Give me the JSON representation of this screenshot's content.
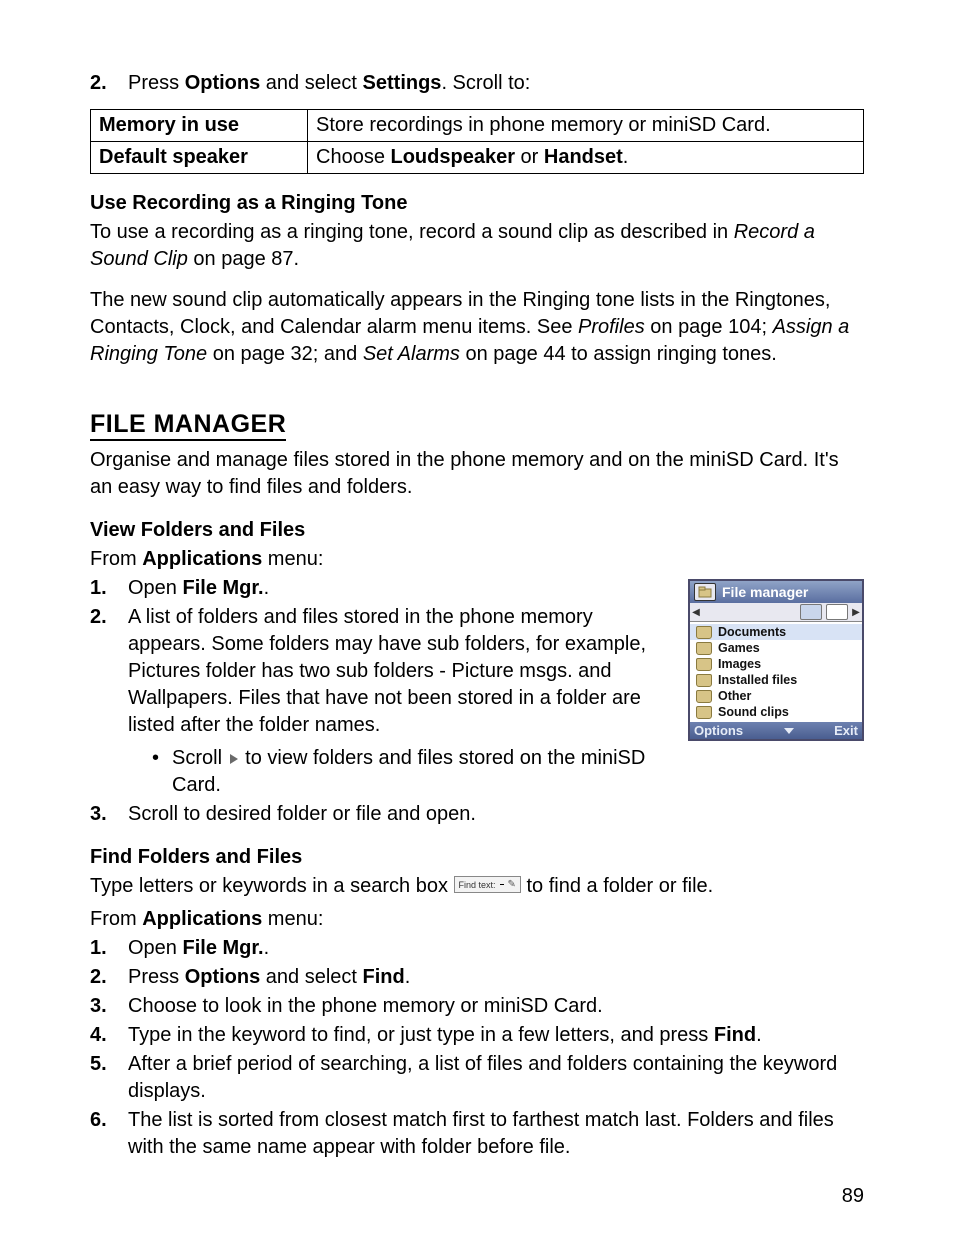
{
  "intro_list": {
    "n1": "2.",
    "t1_a": "Press ",
    "t1_b": "Options",
    "t1_c": " and select ",
    "t1_d": "Settings",
    "t1_e": ". Scroll to:"
  },
  "table": {
    "r1k": "Memory in use",
    "r1v": "Store recordings in phone memory or miniSD Card.",
    "r2k": "Default speaker",
    "r2v_a": "Choose ",
    "r2v_b": "Loudspeaker",
    "r2v_c": " or ",
    "r2v_d": "Handset",
    "r2v_e": "."
  },
  "sec1": {
    "title": "Use Recording as a Ringing Tone",
    "p1_a": "To use a recording as a ringing tone, record a sound clip as described in ",
    "p1_b": "Record a Sound Clip",
    "p1_c": " on page 87.",
    "p2_a": "The new sound clip automatically appears in the Ringing tone lists in the Ringtones, Contacts, Clock, and Calendar alarm menu items. See ",
    "p2_b": "Profiles",
    "p2_c": " on page 104; ",
    "p2_d": "Assign a Ringing Tone",
    "p2_e": " on page 32; and ",
    "p2_f": "Set Alarms",
    "p2_g": " on page 44 to assign ringing tones."
  },
  "h2": "FILE MANAGER",
  "fm_intro": "Organise and manage files stored in the phone memory and on the miniSD Card. It's an easy way to find files and folders.",
  "sec2": {
    "title": "View Folders and Files",
    "from_a": "From ",
    "from_b": "Applications",
    "from_c": " menu:",
    "l1_a": "Open ",
    "l1_b": "File Mgr.",
    "l1_c": ".",
    "l2": "A list of folders and files stored in the phone memory appears. Some folders may have sub folders, for example, Pictures folder has two sub folders - Picture msgs. and Wallpapers. Files that have not been stored in a folder are listed after the folder names.",
    "l2_sub_a": "Scroll ",
    "l2_sub_b": " to view folders and files stored on the miniSD Card.",
    "l3": "Scroll to desired folder or file and open."
  },
  "phone": {
    "title": "File manager",
    "items": [
      "Documents",
      "Games",
      "Images",
      "Installed files",
      "Other",
      "Sound clips"
    ],
    "sk_left": "Options",
    "sk_right": "Exit"
  },
  "sec3": {
    "title": "Find Folders and Files",
    "p1_a": "Type letters or keywords in a search box ",
    "p1_b": " to find a folder or file.",
    "search_label": "Find text:",
    "from_a": "From ",
    "from_b": "Applications",
    "from_c": " menu:",
    "l1_a": "Open ",
    "l1_b": "File Mgr.",
    "l1_c": ".",
    "l2_a": "Press ",
    "l2_b": "Options",
    "l2_c": " and select ",
    "l2_d": "Find",
    "l2_e": ".",
    "l3": "Choose to look in the phone memory or miniSD Card.",
    "l4_a": "Type in the keyword to find, or just type in a few letters, and press ",
    "l4_b": "Find",
    "l4_c": ".",
    "l5": "After a brief period of searching, a list of files and folders containing the keyword displays.",
    "l6": "The list is sorted from closest match first to farthest match last. Folders and files with the same name appear with folder before file."
  },
  "nums": {
    "n1": "1.",
    "n2": "2.",
    "n3": "3.",
    "n4": "4.",
    "n5": "5.",
    "n6": "6."
  },
  "page_number": "89"
}
